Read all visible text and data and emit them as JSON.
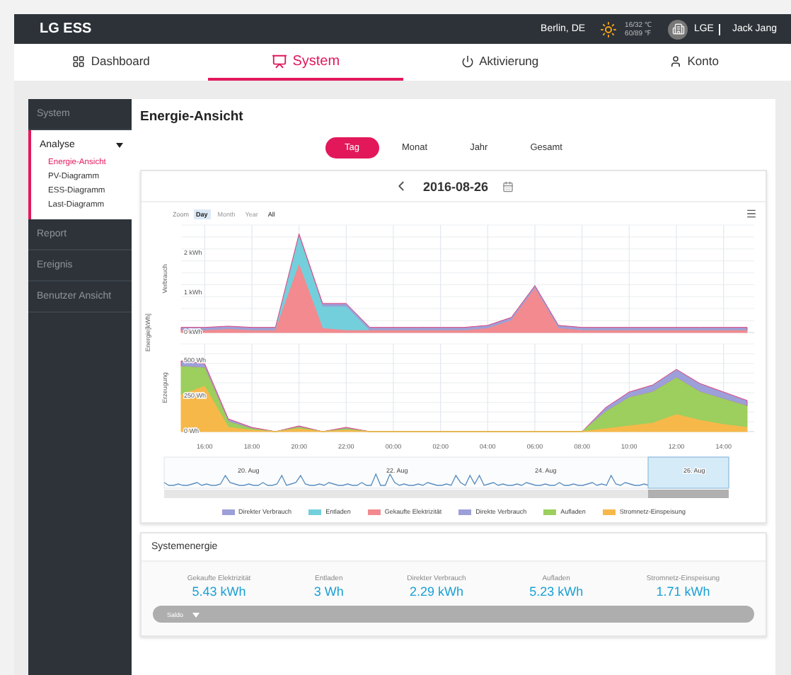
{
  "header": {
    "brand": "LG ESS",
    "city": "Berlin, DE",
    "temp_c": "16/32 ℃",
    "temp_f": "60/89 ℉",
    "company": "LGE",
    "user": "Jack Jang"
  },
  "nav": [
    {
      "label": "Dashboard",
      "selected": false
    },
    {
      "label": "System",
      "selected": true
    },
    {
      "label": "Aktivierung",
      "selected": false
    },
    {
      "label": "Konto",
      "selected": false
    }
  ],
  "sidebar": [
    {
      "label": "System",
      "selected": false
    },
    {
      "label": "Analyse",
      "selected": true,
      "expanded": true,
      "children": [
        {
          "label": "Energie-Ansicht",
          "selected": true
        },
        {
          "label": "PV-Diagramm",
          "selected": false
        },
        {
          "label": "ESS-Diagramm",
          "selected": false
        },
        {
          "label": "Last-Diagramm",
          "selected": false
        }
      ]
    },
    {
      "label": "Report",
      "selected": false
    },
    {
      "label": "Ereignis",
      "selected": false
    },
    {
      "label": "Benutzer Ansicht",
      "selected": false
    }
  ],
  "page_title": "Energie-Ansicht",
  "periods": [
    {
      "label": "Tag",
      "selected": true
    },
    {
      "label": "Monat",
      "selected": false
    },
    {
      "label": "Jahr",
      "selected": false
    },
    {
      "label": "Gesamt",
      "selected": false
    }
  ],
  "chart": {
    "date": "2016-08-26",
    "zoom_label": "Zoom",
    "zoom_options": [
      {
        "label": "Day",
        "selected": true,
        "disabled": false
      },
      {
        "label": "Month",
        "selected": false,
        "disabled": true
      },
      {
        "label": "Year",
        "selected": false,
        "disabled": true
      },
      {
        "label": "All",
        "selected": false,
        "disabled": false
      }
    ],
    "axis_label": "Energie[kWh]",
    "panels": [
      {
        "chart_data": {
          "type": "area",
          "stacked": true,
          "ylabel": "Verbrauch",
          "x": [
            "2016-08-25T15:00",
            "2016-08-25T16:00",
            "2016-08-25T17:00",
            "2016-08-25T18:00",
            "2016-08-25T19:00",
            "2016-08-25T20:00",
            "2016-08-25T21:00",
            "2016-08-25T22:00",
            "2016-08-25T23:00",
            "2016-08-26T00:00",
            "2016-08-26T01:00",
            "2016-08-26T02:00",
            "2016-08-26T03:00",
            "2016-08-26T04:00",
            "2016-08-26T05:00",
            "2016-08-26T06:00",
            "2016-08-26T07:00",
            "2016-08-26T08:00",
            "2016-08-26T09:00",
            "2016-08-26T10:00",
            "2016-08-26T11:00",
            "2016-08-26T12:00",
            "2016-08-26T13:00",
            "2016-08-26T14:00",
            "2016-08-26T15:00"
          ],
          "xlim": [
            "2016-08-25T15:00",
            "2016-08-26T15:18"
          ],
          "ylim": [
            0,
            2.7
          ],
          "yticks": [
            {
              "value": 0,
              "label": "0 kWh"
            },
            {
              "value": 1,
              "label": "1 kWh"
            },
            {
              "value": 2,
              "label": "2 kWh"
            }
          ],
          "grid": true,
          "series": [
            {
              "name": "Direkter Verbrauch",
              "color": "#9d9fd9",
              "values": [
                0.08,
                0.08,
                0.08,
                0.08,
                0.08,
                0.08,
                0.08,
                0.08,
                0.08,
                0.08,
                0.08,
                0.08,
                0.08,
                0.08,
                0.08,
                0.08,
                0.08,
                0.08,
                0.08,
                0.08,
                0.08,
                0.08,
                0.08,
                0.08,
                0.08
              ]
            },
            {
              "name": "Entladen",
              "color": "#74cfdc",
              "values": [
                0,
                0,
                0,
                0,
                0,
                0.7,
                0.55,
                0.6,
                0,
                0,
                0,
                0,
                0,
                0,
                0,
                0,
                0,
                0,
                0,
                0,
                0,
                0,
                0,
                0,
                0
              ]
            },
            {
              "name": "Gekaufte Elektrizität",
              "color": "#f28a8f",
              "values": [
                0.05,
                0.05,
                0.08,
                0.05,
                0.05,
                1.7,
                0.1,
                0.05,
                0.05,
                0.05,
                0.05,
                0.05,
                0.05,
                0.1,
                0.3,
                1.1,
                0.1,
                0.05,
                0.05,
                0.05,
                0.05,
                0.05,
                0.05,
                0.05,
                0.05
              ]
            }
          ]
        }
      },
      {
        "chart_data": {
          "type": "area",
          "stacked": true,
          "ylabel": "Erzeugung",
          "x": [
            "2016-08-25T15:00",
            "2016-08-25T16:00",
            "2016-08-25T17:00",
            "2016-08-25T18:00",
            "2016-08-25T19:00",
            "2016-08-25T20:00",
            "2016-08-25T21:00",
            "2016-08-25T22:00",
            "2016-08-25T23:00",
            "2016-08-26T00:00",
            "2016-08-26T01:00",
            "2016-08-26T02:00",
            "2016-08-26T03:00",
            "2016-08-26T04:00",
            "2016-08-26T05:00",
            "2016-08-26T06:00",
            "2016-08-26T07:00",
            "2016-08-26T08:00",
            "2016-08-26T09:00",
            "2016-08-26T10:00",
            "2016-08-26T11:00",
            "2016-08-26T12:00",
            "2016-08-26T13:00",
            "2016-08-26T14:00",
            "2016-08-26T15:00"
          ],
          "xlim": [
            "2016-08-25T15:00",
            "2016-08-26T15:18"
          ],
          "ylim": [
            0,
            620
          ],
          "yticks": [
            {
              "value": 0,
              "label": "0 Wh"
            },
            {
              "value": 250,
              "label": "250 Wh"
            },
            {
              "value": 500,
              "label": "500 Wh"
            }
          ],
          "xticks": [
            {
              "value": "2016-08-25T16:00",
              "label": "16:00"
            },
            {
              "value": "2016-08-25T18:00",
              "label": "18:00"
            },
            {
              "value": "2016-08-25T20:00",
              "label": "20:00"
            },
            {
              "value": "2016-08-25T22:00",
              "label": "22:00"
            },
            {
              "value": "2016-08-26T00:00",
              "label": "00:00"
            },
            {
              "value": "2016-08-26T02:00",
              "label": "02:00"
            },
            {
              "value": "2016-08-26T04:00",
              "label": "04:00"
            },
            {
              "value": "2016-08-26T06:00",
              "label": "06:00"
            },
            {
              "value": "2016-08-26T08:00",
              "label": "08:00"
            },
            {
              "value": "2016-08-26T10:00",
              "label": "10:00"
            },
            {
              "value": "2016-08-26T12:00",
              "label": "12:00"
            },
            {
              "value": "2016-08-26T14:00",
              "label": "14:00"
            }
          ],
          "grid": true,
          "series": [
            {
              "name": "Direkte Verbrauch",
              "color": "#9d9fd9",
              "values": [
                40,
                30,
                20,
                10,
                0,
                10,
                0,
                10,
                0,
                0,
                0,
                0,
                0,
                0,
                0,
                0,
                0,
                0,
                30,
                40,
                50,
                60,
                60,
                50,
                40
              ]
            },
            {
              "name": "Aufladen",
              "color": "#9ccf5d",
              "values": [
                200,
                130,
                40,
                10,
                0,
                10,
                0,
                10,
                0,
                0,
                0,
                0,
                0,
                0,
                0,
                0,
                0,
                0,
                120,
                200,
                220,
                260,
                200,
                180,
                150
              ]
            },
            {
              "name": "Stromnetz-Einspeisung",
              "color": "#f7b84a",
              "values": [
                260,
                320,
                30,
                10,
                0,
                20,
                0,
                10,
                0,
                0,
                0,
                0,
                0,
                0,
                0,
                0,
                0,
                0,
                20,
                40,
                60,
                120,
                80,
                50,
                30
              ]
            }
          ]
        }
      }
    ],
    "navigator": {
      "labels": [
        "20. Aug",
        "22. Aug",
        "24. Aug",
        "26. Aug"
      ]
    }
  },
  "system_energy": {
    "title": "Systemenergie",
    "stats": [
      {
        "label": "Gekaufte Elektrizität",
        "value": "5.43 kWh"
      },
      {
        "label": "Entladen",
        "value": "3 Wh"
      },
      {
        "label": "Direkter Verbrauch",
        "value": "2.29 kWh"
      },
      {
        "label": "Aufladen",
        "value": "5.23 kWh"
      },
      {
        "label": "Stromnetz-Einspeisung",
        "value": "1.71 kWh"
      }
    ],
    "balance": {
      "label": "Saldo",
      "expanded": false
    }
  }
}
